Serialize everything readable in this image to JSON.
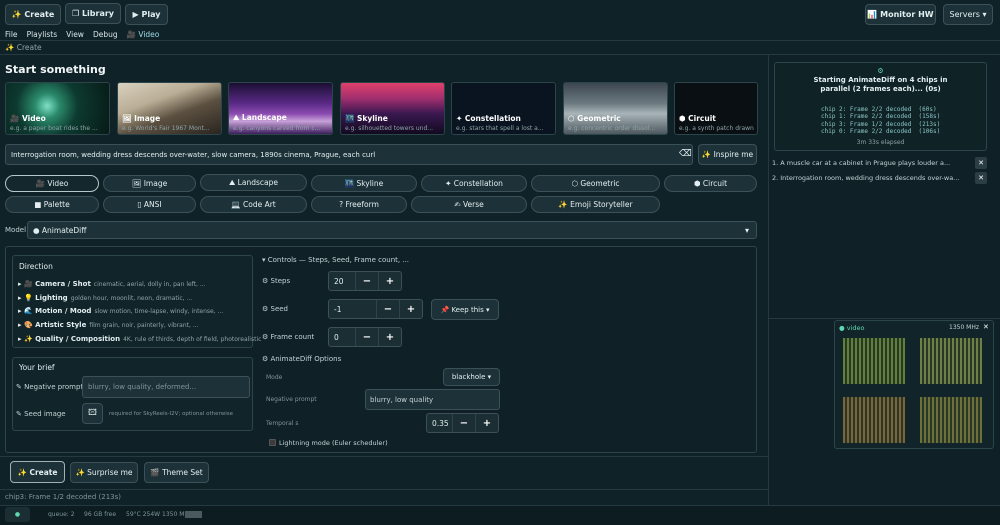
{
  "topbar": {
    "create": "✨ Create",
    "library": "❐ Library",
    "play": "▶ Play",
    "monitor": "📊 Monitor HW",
    "servers": "Servers ▾"
  },
  "menu": [
    "File",
    "Playlists",
    "View",
    "Debug",
    "🎥 Video"
  ],
  "breadcrumb": "✨ Create",
  "start_title": "Start something",
  "cards": [
    {
      "title": "🎥 Video",
      "sub": "e.g. a paper boat rides the ..."
    },
    {
      "title": "🖼 Image",
      "sub": "e.g. World's Fair 1967 Mont..."
    },
    {
      "title": "⛰ Landscape",
      "sub": "e.g. canyons carved from c..."
    },
    {
      "title": "🌃 Skyline",
      "sub": "e.g. silhouetted towers und..."
    },
    {
      "title": "✦ Constellation",
      "sub": "e.g. stars that spell a lost a..."
    },
    {
      "title": "⬡ Geometric",
      "sub": "e.g. concentric order dissol..."
    },
    {
      "title": "⬢ Circuit",
      "sub": "e.g. a synth patch drawn"
    }
  ],
  "prompt": {
    "value": "Interrogation room, wedding dress descends over-water, slow camera, 1890s cinema, Prague, each curl",
    "clear": "⌫",
    "inspire": "✨ Inspire me"
  },
  "modes_row1": [
    "🎥 Video",
    "🖼 Image",
    "⛰ Landscape",
    "🌃 Skyline",
    "✦ Constellation",
    "⬡ Geometric",
    "⬢ Circuit"
  ],
  "modes_row2": [
    "■ Palette",
    "▯ ANSI",
    "💻 Code Art",
    "? Freeform",
    "✍ Verse",
    "✨ Emoji Storyteller"
  ],
  "model": {
    "label": "Model",
    "value": "● AnimateDiff",
    "caret": "▾"
  },
  "direction": {
    "title": "Direction",
    "rows": [
      {
        "label": "▸ 🎥 Camera / Shot",
        "desc": "cinematic, aerial, dolly in, pan left, ..."
      },
      {
        "label": "▸ 💡 Lighting",
        "desc": "golden hour, moonlit, neon, dramatic, ..."
      },
      {
        "label": "▸ 🌊 Motion / Mood",
        "desc": "slow motion, time-lapse, windy, intense, ..."
      },
      {
        "label": "▸ 🎨 Artistic Style",
        "desc": "film grain, noir, painterly, vibrant, ..."
      },
      {
        "label": "▸ ✨ Quality / Composition",
        "desc": "4K, rule of thirds, depth of field, photorealistic"
      }
    ]
  },
  "brief": {
    "title": "Your brief",
    "neg_label": "✎ Negative prompt",
    "neg_placeholder": "blurry, low quality, deformed...",
    "seed_label": "✎ Seed image",
    "seed_note": "required for SkyReels-I2V; optional otherwise",
    "seed_icon": "🖾"
  },
  "controls": {
    "header": "▾ Controls — Steps, Seed, Frame count, ...",
    "steps_label": "⚙ Steps",
    "steps": "20",
    "seed_label": "⚙ Seed",
    "seed": "-1",
    "keep": "📌 Keep this ▾",
    "frames_label": "⚙ Frame count",
    "frames": "0",
    "minus": "−",
    "plus": "+"
  },
  "options": {
    "header": "⚙ AnimateDiff Options",
    "mode_label": "Mode",
    "mode_value": "blackhole ▾",
    "neg_label": "Negative prompt",
    "neg_value": "blurry, low quality",
    "temporal_label": "Temporal s",
    "temporal_value": "0.35",
    "lightning": "Lightning mode (Euler scheduler)"
  },
  "bottom": {
    "create": "✨ Create",
    "surprise": "✨ Surprise me",
    "theme": "🎬 Theme Set"
  },
  "status_line": "chip3: Frame 1/2 decoded (213s)",
  "footer": {
    "dot": "●",
    "queue": "queue: 2",
    "free": "96 GB free",
    "hw": "59°C  254W  1350 MHz"
  },
  "job": {
    "icon": "⚙",
    "title": "Starting AnimateDiff on 4 chips in parallel (2 frames each)... (0s)",
    "lines": [
      "chip 2: Frame 2/2 decoded  (60s)",
      "chip 1: Frame 2/2 decoded  (158s)",
      "chip 3: Frame 1/2 decoded  (213s)",
      "chip 0: Frame 2/2 decoded  (106s)"
    ],
    "elapsed": "3m 33s elapsed"
  },
  "queue": [
    "1. A muscle car at a cabinet in Prague plays louder a...",
    "2. Interrogation room, wedding dress descends over-wa..."
  ],
  "preview": {
    "title": "● video",
    "mhz": "1350 MHz",
    "close": "✕"
  },
  "colors": {
    "accent": "#5fd7b0",
    "bg": "#0f2228"
  }
}
